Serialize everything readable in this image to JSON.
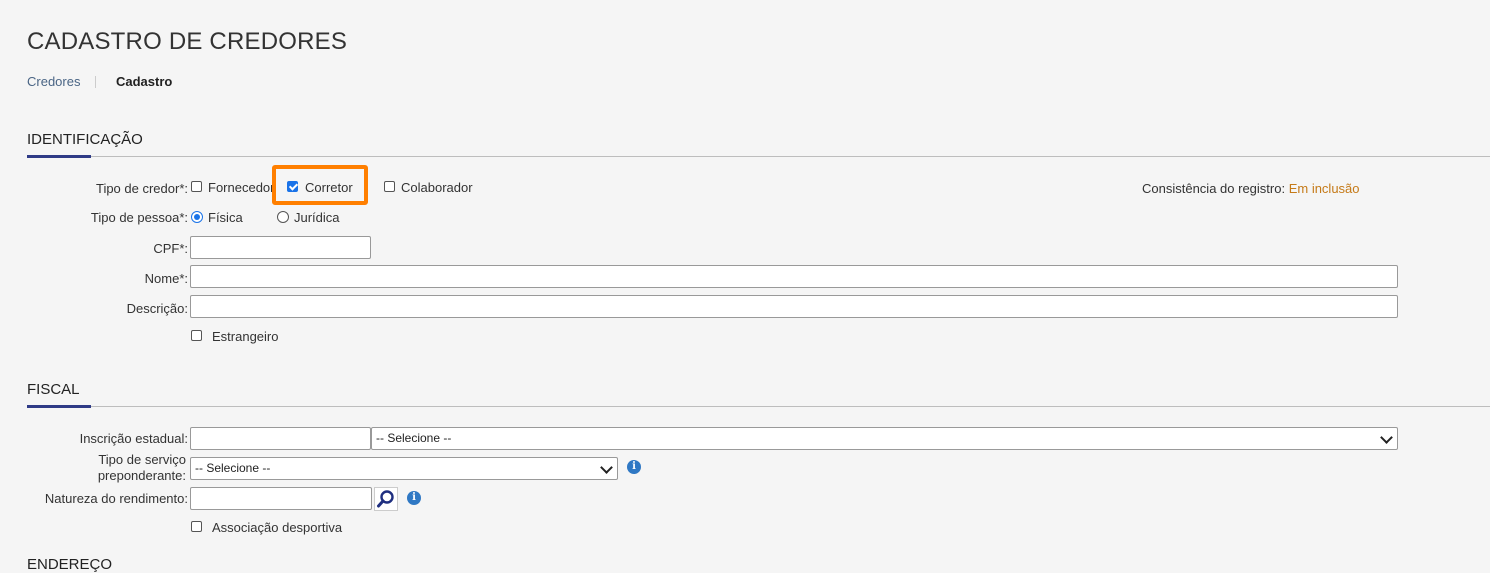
{
  "page": {
    "title": "CADASTRO DE CREDORES",
    "breadcrumb": {
      "parent": "Credores",
      "current": "Cadastro"
    }
  },
  "identificacao": {
    "section_title": "IDENTIFICAÇÃO",
    "tipo_credor": {
      "label": "Tipo de credor*:",
      "options": [
        {
          "label": "Fornecedor",
          "checked": false
        },
        {
          "label": "Corretor",
          "checked": true
        },
        {
          "label": "Colaborador",
          "checked": false
        }
      ]
    },
    "consistencia": {
      "label": "Consistência do registro:",
      "value": "Em inclusão"
    },
    "tipo_pessoa": {
      "label": "Tipo de pessoa*:",
      "options": [
        {
          "label": "Física",
          "selected": true
        },
        {
          "label": "Jurídica",
          "selected": false
        }
      ]
    },
    "cpf": {
      "label": "CPF*:",
      "value": ""
    },
    "nome": {
      "label": "Nome*:",
      "value": ""
    },
    "descricao": {
      "label": "Descrição:",
      "value": ""
    },
    "estrangeiro": {
      "label": "Estrangeiro",
      "checked": false
    }
  },
  "fiscal": {
    "section_title": "FISCAL",
    "inscricao": {
      "label": "Inscrição estadual:",
      "value": "",
      "select_value": "-- Selecione --"
    },
    "tipo_servico": {
      "label_line1": "Tipo de serviço",
      "label_line2": "preponderante:",
      "select_value": "-- Selecione --"
    },
    "natureza": {
      "label": "Natureza do rendimento:",
      "value": ""
    },
    "associacao": {
      "label": "Associação desportiva",
      "checked": false
    }
  },
  "next_section": {
    "section_title": "ENDEREÇO"
  },
  "colors": {
    "accent": "#2f3b86",
    "highlight": "#ff7f00",
    "status": "#c57a18",
    "checkbox": "#1a73e8"
  }
}
